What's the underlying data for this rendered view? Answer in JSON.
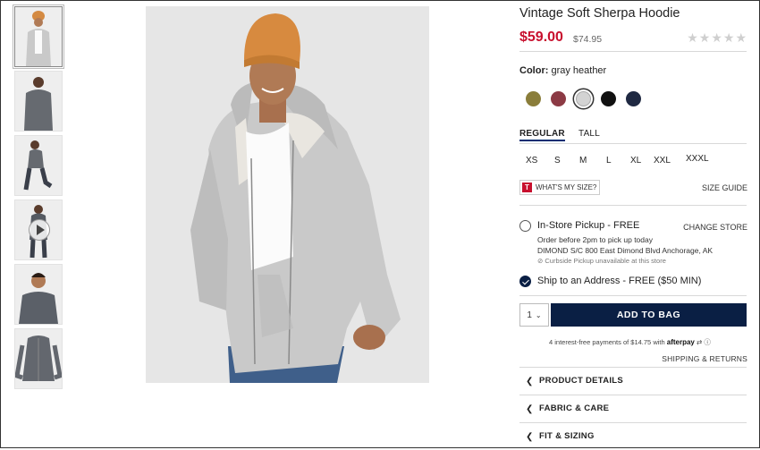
{
  "product": {
    "title": "Vintage Soft Sherpa Hoodie",
    "sale_price": "$59.00",
    "original_price": "$74.95",
    "rating_stars": "★★★★★",
    "rating_value": 0,
    "color_label": "Color:",
    "color_value": "gray heather",
    "swatches": [
      {
        "name": "olive",
        "color": "#8a7d3a",
        "selected": false
      },
      {
        "name": "burgundy",
        "color": "#8c3a44",
        "selected": false
      },
      {
        "name": "gray heather",
        "color": "#d3d3d3",
        "selected": true
      },
      {
        "name": "black",
        "color": "#111111",
        "selected": false
      },
      {
        "name": "navy",
        "color": "#1f2942",
        "selected": false
      }
    ]
  },
  "fit_tabs": [
    "REGULAR",
    "TALL"
  ],
  "sizes": [
    "XS",
    "S",
    "M",
    "L",
    "XL",
    "XXL",
    "XXXL"
  ],
  "whats_my_size": {
    "icon": "T",
    "label": "WHAT'S MY SIZE?"
  },
  "size_guide": "SIZE GUIDE",
  "pickup": {
    "title": "In-Store Pickup - FREE",
    "change_store": "CHANGE STORE",
    "line1": "Order before 2pm to pick up today",
    "line2": "DIMOND S/C 800 East Dimond Blvd  Anchorage, AK",
    "line3": "⊘ Curbside Pickup unavailable at this store"
  },
  "ship": {
    "title": "Ship to an Address - FREE ($50 MIN)"
  },
  "quantity": "1",
  "add_to_bag": "ADD TO BAG",
  "afterpay": {
    "text": "4 interest-free payments of $14.75 with",
    "brand": "afterpay",
    "info_icon": "ⓘ"
  },
  "shipping_returns": "SHIPPING & RETURNS",
  "accordion": [
    "PRODUCT DETAILS",
    "FABRIC & CARE",
    "FIT & SIZING"
  ],
  "accent_colors": {
    "sale": "#c8102e",
    "navy": "#0a1f44"
  }
}
